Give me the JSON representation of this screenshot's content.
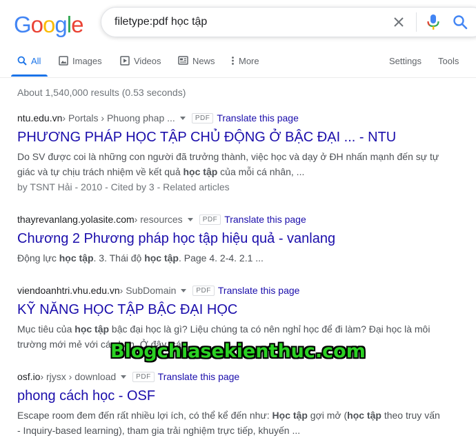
{
  "logo": {
    "letters": [
      "G",
      "o",
      "o",
      "g",
      "l",
      "e"
    ],
    "colors": [
      "#4285f4",
      "#ea4335",
      "#fbbc05",
      "#4285f4",
      "#34a853",
      "#ea4335"
    ]
  },
  "search": {
    "query": "filetype:pdf học tập"
  },
  "tabs": {
    "all": "All",
    "images": "Images",
    "videos": "Videos",
    "news": "News",
    "more": "More",
    "settings": "Settings",
    "tools": "Tools"
  },
  "stats": "About 1,540,000 results (0.53 seconds)",
  "results": [
    {
      "site": "ntu.edu.vn",
      "path": " › Portals › Phuong phap ...",
      "badge": "PDF",
      "translate": "Translate this page",
      "title": "PHƯƠNG PHÁP HỌC TẬP CHỦ ĐỘNG Ở BẬC ĐẠI ... - NTU",
      "snippet": [
        {
          "t": "Do SV được coi là những con người đã trưởng thành, việc học và dạy ở ĐH nhấn mạnh đến sự tự giác và tự chịu trách nhiệm về kết quả ",
          "b": false
        },
        {
          "t": "học tập",
          "b": true
        },
        {
          "t": " của mỗi cá nhân, ...",
          "b": false
        }
      ],
      "meta": "by TSNT Hải - 2010 - Cited by 3 - Related articles"
    },
    {
      "site": "thayrevanlang.yolasite.com",
      "path": " › resources",
      "badge": "PDF",
      "translate": "Translate this page",
      "title": "Chương 2 Phương pháp học tập hiệu quả - vanlang",
      "snippet": [
        {
          "t": "Động lực ",
          "b": false
        },
        {
          "t": "học tập",
          "b": true
        },
        {
          "t": ". 3. Thái độ ",
          "b": false
        },
        {
          "t": "học tập",
          "b": true
        },
        {
          "t": ". Page 4. 2-4. 2.1 ...",
          "b": false
        }
      ],
      "meta": ""
    },
    {
      "site": "viendoanhtri.vhu.edu.vn",
      "path": " › SubDomain",
      "badge": "PDF",
      "translate": "Translate this page",
      "title": "KỸ NĂNG HỌC TẬP BẬC ĐẠI HỌC",
      "snippet": [
        {
          "t": "Mục tiêu của ",
          "b": false
        },
        {
          "t": "học tập",
          "b": true
        },
        {
          "t": " bậc đại học là gì? Liệu chúng ta có nên nghỉ học để đi làm? Đại học là môi trường mới mẻ với các bạn. Ở đây, các ...",
          "b": false
        }
      ],
      "meta": ""
    },
    {
      "site": "osf.io",
      "path": " › rjysx › download",
      "badge": "PDF",
      "translate": "Translate this page",
      "title": "phong cách học - OSF",
      "snippet": [
        {
          "t": "Escape room đem đến rất nhiều lợi ích, có thể kể đến như: ",
          "b": false
        },
        {
          "t": "Học tập",
          "b": true
        },
        {
          "t": " gợi mở (",
          "b": false
        },
        {
          "t": "học tập",
          "b": true
        },
        {
          "t": " theo truy vấn - Inquiry-based learning), tham gia trải nghiệm trực tiếp, khuyến ...",
          "b": false
        }
      ],
      "meta": ""
    }
  ],
  "watermark": "Blogchiasekienthuc.com"
}
